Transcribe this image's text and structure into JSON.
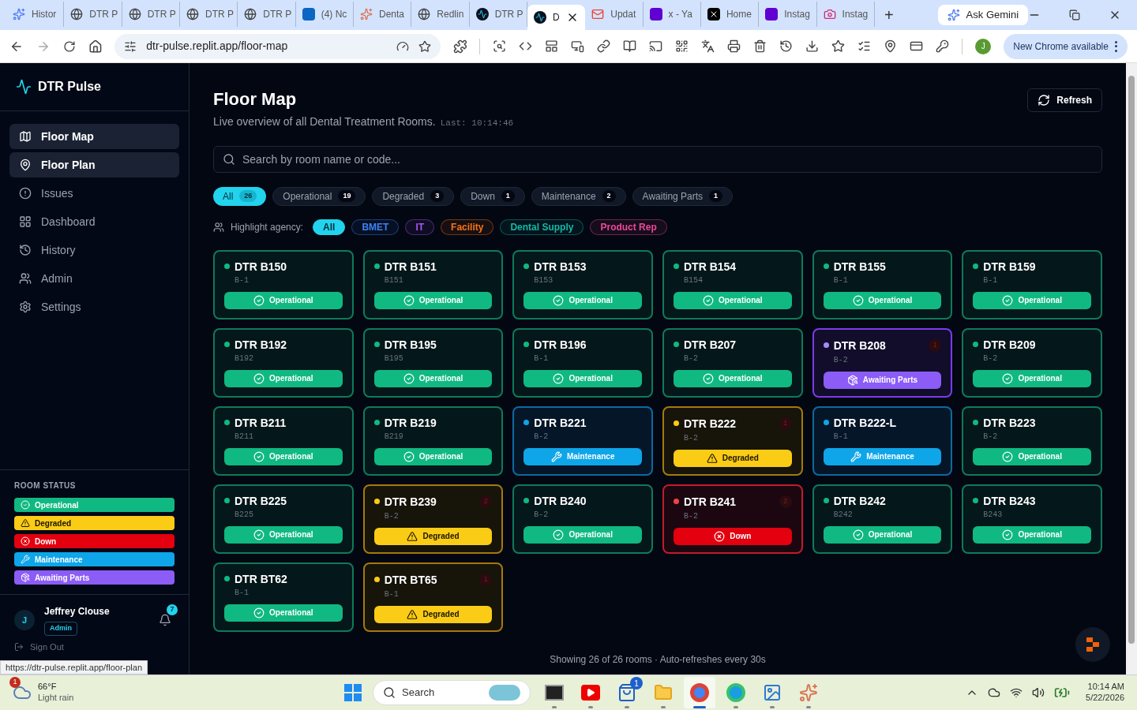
{
  "browser": {
    "tabs": [
      {
        "title": "Histor",
        "kind": "gemini",
        "selected": false
      },
      {
        "title": "DTR P",
        "kind": "globe",
        "selected": false
      },
      {
        "title": "DTR P",
        "kind": "globe",
        "selected": false
      },
      {
        "title": "DTR P",
        "kind": "globe",
        "selected": false
      },
      {
        "title": "DTR P",
        "kind": "globe",
        "selected": false
      },
      {
        "title": "(4) Nc",
        "kind": "linkedin",
        "selected": false
      },
      {
        "title": "Denta",
        "kind": "burst",
        "selected": false
      },
      {
        "title": "Redlin",
        "kind": "globe",
        "selected": false
      },
      {
        "title": "DTR P",
        "kind": "pulse",
        "selected": false
      },
      {
        "title": "D",
        "kind": "pulse",
        "selected": true
      },
      {
        "title": "Updat",
        "kind": "mail",
        "selected": false
      },
      {
        "title": "x - Ya",
        "kind": "yahoo",
        "selected": false
      },
      {
        "title": "Home",
        "kind": "x",
        "selected": false
      },
      {
        "title": "Instag",
        "kind": "yahoo",
        "selected": false
      },
      {
        "title": "Instag",
        "kind": "camera",
        "selected": false
      }
    ],
    "new_tab": "+",
    "ask_gemini": "Ask Gemini",
    "url": "dtr-pulse.replit.app/floor-map",
    "profile": "J",
    "update": "New Chrome available"
  },
  "sidebar": {
    "brand": "DTR Pulse",
    "nav": [
      {
        "label": "Floor Map",
        "kind": "map",
        "selected": true
      },
      {
        "label": "Floor Plan",
        "kind": "pin",
        "selected": true
      },
      {
        "label": "Issues",
        "kind": "alert",
        "selected": false
      },
      {
        "label": "Dashboard",
        "kind": "grid",
        "selected": false
      },
      {
        "label": "History",
        "kind": "history",
        "selected": false
      },
      {
        "label": "Admin",
        "kind": "users",
        "selected": false
      },
      {
        "label": "Settings",
        "kind": "gear",
        "selected": false
      }
    ],
    "legend_title": "ROOM STATUS",
    "legend": [
      {
        "label": "Operational",
        "kind": "operational"
      },
      {
        "label": "Degraded",
        "kind": "degraded"
      },
      {
        "label": "Down",
        "kind": "down"
      },
      {
        "label": "Maintenance",
        "kind": "maintenance"
      },
      {
        "label": "Awaiting Parts",
        "kind": "awaiting"
      }
    ],
    "user": {
      "initial": "J",
      "name": "Jeffrey Clouse",
      "role": "Admin",
      "notifications": "7",
      "sign_out": "Sign Out"
    }
  },
  "status_url": "https://dtr-pulse.replit.app/floor-plan",
  "main": {
    "title": "Floor Map",
    "subtitle": "Live overview of all Dental Treatment Rooms.",
    "last": "Last: 10:14:46",
    "refresh": "Refresh",
    "search_placeholder": "Search by room name or code...",
    "filters": [
      {
        "label": "All",
        "count": "26",
        "selected": true
      },
      {
        "label": "Operational",
        "count": "19",
        "selected": false
      },
      {
        "label": "Degraded",
        "count": "3",
        "selected": false
      },
      {
        "label": "Down",
        "count": "1",
        "selected": false
      },
      {
        "label": "Maintenance",
        "count": "2",
        "selected": false
      },
      {
        "label": "Awaiting Parts",
        "count": "1",
        "selected": false
      }
    ],
    "agency_label": "Highlight agency:",
    "agencies": [
      {
        "label": "All",
        "color": "#22d3ee",
        "selected": true
      },
      {
        "label": "BMET",
        "color": "#3b82f6",
        "selected": false
      },
      {
        "label": "IT",
        "color": "#a855f7",
        "selected": false
      },
      {
        "label": "Facility",
        "color": "#f97316",
        "selected": false
      },
      {
        "label": "Dental Supply",
        "color": "#14b8a6",
        "selected": false
      },
      {
        "label": "Product Rep",
        "color": "#ec4899",
        "selected": false
      }
    ],
    "rooms": [
      {
        "name": "DTR B150",
        "code": "B-1",
        "kind": "operational",
        "status": "Operational"
      },
      {
        "name": "DTR B151",
        "code": "B151",
        "kind": "operational",
        "status": "Operational"
      },
      {
        "name": "DTR B153",
        "code": "B153",
        "kind": "operational",
        "status": "Operational"
      },
      {
        "name": "DTR B154",
        "code": "B154",
        "kind": "operational",
        "status": "Operational"
      },
      {
        "name": "DTR B155",
        "code": "B-1",
        "kind": "operational",
        "status": "Operational"
      },
      {
        "name": "DTR B159",
        "code": "B-1",
        "kind": "operational",
        "status": "Operational"
      },
      {
        "name": "DTR B192",
        "code": "B192",
        "kind": "operational",
        "status": "Operational"
      },
      {
        "name": "DTR B195",
        "code": "B195",
        "kind": "operational",
        "status": "Operational"
      },
      {
        "name": "DTR B196",
        "code": "B-1",
        "kind": "operational",
        "status": "Operational"
      },
      {
        "name": "DTR B207",
        "code": "B-2",
        "kind": "operational",
        "status": "Operational"
      },
      {
        "name": "DTR B208",
        "code": "B-2",
        "kind": "awaiting",
        "status": "Awaiting Parts",
        "issues": "1"
      },
      {
        "name": "DTR B209",
        "code": "B-2",
        "kind": "operational",
        "status": "Operational"
      },
      {
        "name": "DTR B211",
        "code": "B211",
        "kind": "operational",
        "status": "Operational"
      },
      {
        "name": "DTR B219",
        "code": "B219",
        "kind": "operational",
        "status": "Operational"
      },
      {
        "name": "DTR B221",
        "code": "B-2",
        "kind": "maintenance",
        "status": "Maintenance"
      },
      {
        "name": "DTR B222",
        "code": "B-2",
        "kind": "degraded",
        "status": "Degraded",
        "issues": "1"
      },
      {
        "name": "DTR B222-L",
        "code": "B-1",
        "kind": "maintenance",
        "status": "Maintenance"
      },
      {
        "name": "DTR B223",
        "code": "B-2",
        "kind": "operational",
        "status": "Operational"
      },
      {
        "name": "DTR B225",
        "code": "B225",
        "kind": "operational",
        "status": "Operational"
      },
      {
        "name": "DTR B239",
        "code": "B-2",
        "kind": "degraded",
        "status": "Degraded",
        "issues": "2"
      },
      {
        "name": "DTR B240",
        "code": "B-2",
        "kind": "operational",
        "status": "Operational"
      },
      {
        "name": "DTR B241",
        "code": "B-2",
        "kind": "down",
        "status": "Down",
        "issues": "2"
      },
      {
        "name": "DTR B242",
        "code": "B242",
        "kind": "operational",
        "status": "Operational"
      },
      {
        "name": "DTR B243",
        "code": "B243",
        "kind": "operational",
        "status": "Operational"
      },
      {
        "name": "DTR BT62",
        "code": "B-1",
        "kind": "operational",
        "status": "Operational"
      },
      {
        "name": "DTR BT65",
        "code": "B-1",
        "kind": "degraded",
        "status": "Degraded",
        "issues": "1"
      }
    ],
    "footer": "Showing 26 of 26 rooms · Auto-refreshes every 30s"
  },
  "taskbar": {
    "weather_badge": "1",
    "temp": "66°F",
    "weather": "Light rain",
    "search": "Search",
    "time": "10:14 AM",
    "date": "5/22/2026",
    "apps": [
      {
        "kind": "explorer",
        "active": false
      },
      {
        "kind": "video",
        "active": false
      },
      {
        "kind": "store",
        "badge": "1",
        "active": false
      },
      {
        "kind": "folder",
        "active": false
      },
      {
        "kind": "chrome",
        "active": true
      },
      {
        "kind": "edge",
        "active": false
      },
      {
        "kind": "photos",
        "active": false
      },
      {
        "kind": "burst",
        "active": false
      }
    ]
  }
}
